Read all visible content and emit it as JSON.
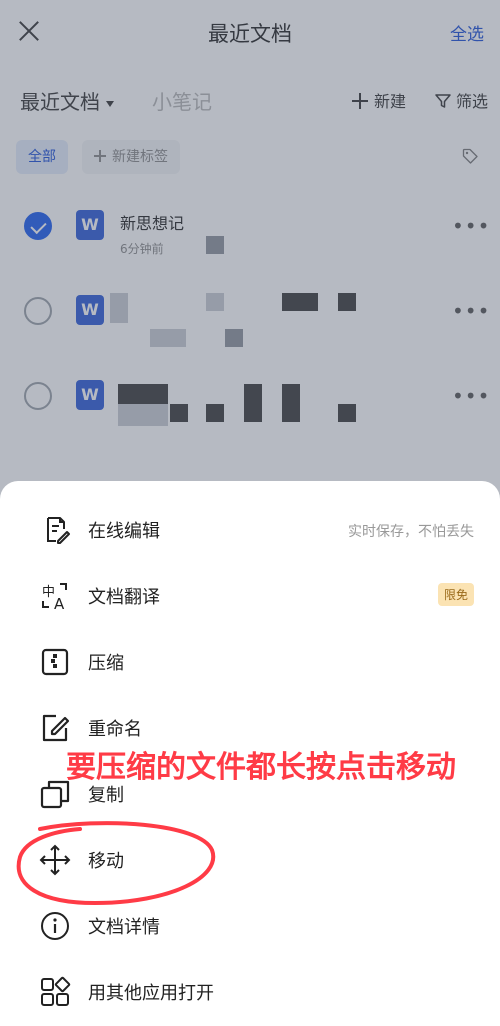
{
  "header": {
    "title": "最近文档",
    "select_all": "全选"
  },
  "tabs": {
    "recent": "最近文档",
    "notes": "小笔记",
    "new": "新建",
    "filter": "筛选"
  },
  "chips": {
    "all": "全部",
    "new_tag": "新建标签"
  },
  "files": [
    {
      "name": "新思想记",
      "time": "6分钟前",
      "selected": true,
      "icon": "W"
    },
    {
      "name": "",
      "time": "",
      "selected": false,
      "icon": "W"
    },
    {
      "name": "",
      "time": "",
      "selected": false,
      "icon": "W"
    }
  ],
  "more_label": "•••",
  "sheet": {
    "items": [
      {
        "label": "在线编辑",
        "icon": "edit-doc-icon",
        "hint": "实时保存，不怕丢失"
      },
      {
        "label": "文档翻译",
        "icon": "translate-icon",
        "badge": "限免"
      },
      {
        "label": "压缩",
        "icon": "compress-icon"
      },
      {
        "label": "重命名",
        "icon": "rename-icon"
      },
      {
        "label": "复制",
        "icon": "copy-icon"
      },
      {
        "label": "移动",
        "icon": "move-icon"
      },
      {
        "label": "文档详情",
        "icon": "info-icon"
      },
      {
        "label": "用其他应用打开",
        "icon": "apps-icon"
      }
    ]
  },
  "annotation": {
    "text": "要压缩的文件都长按点击移动",
    "color": "#ff3b46"
  },
  "colors": {
    "accent": "#1a5cf0",
    "doc_icon": "#2b5bd7"
  }
}
